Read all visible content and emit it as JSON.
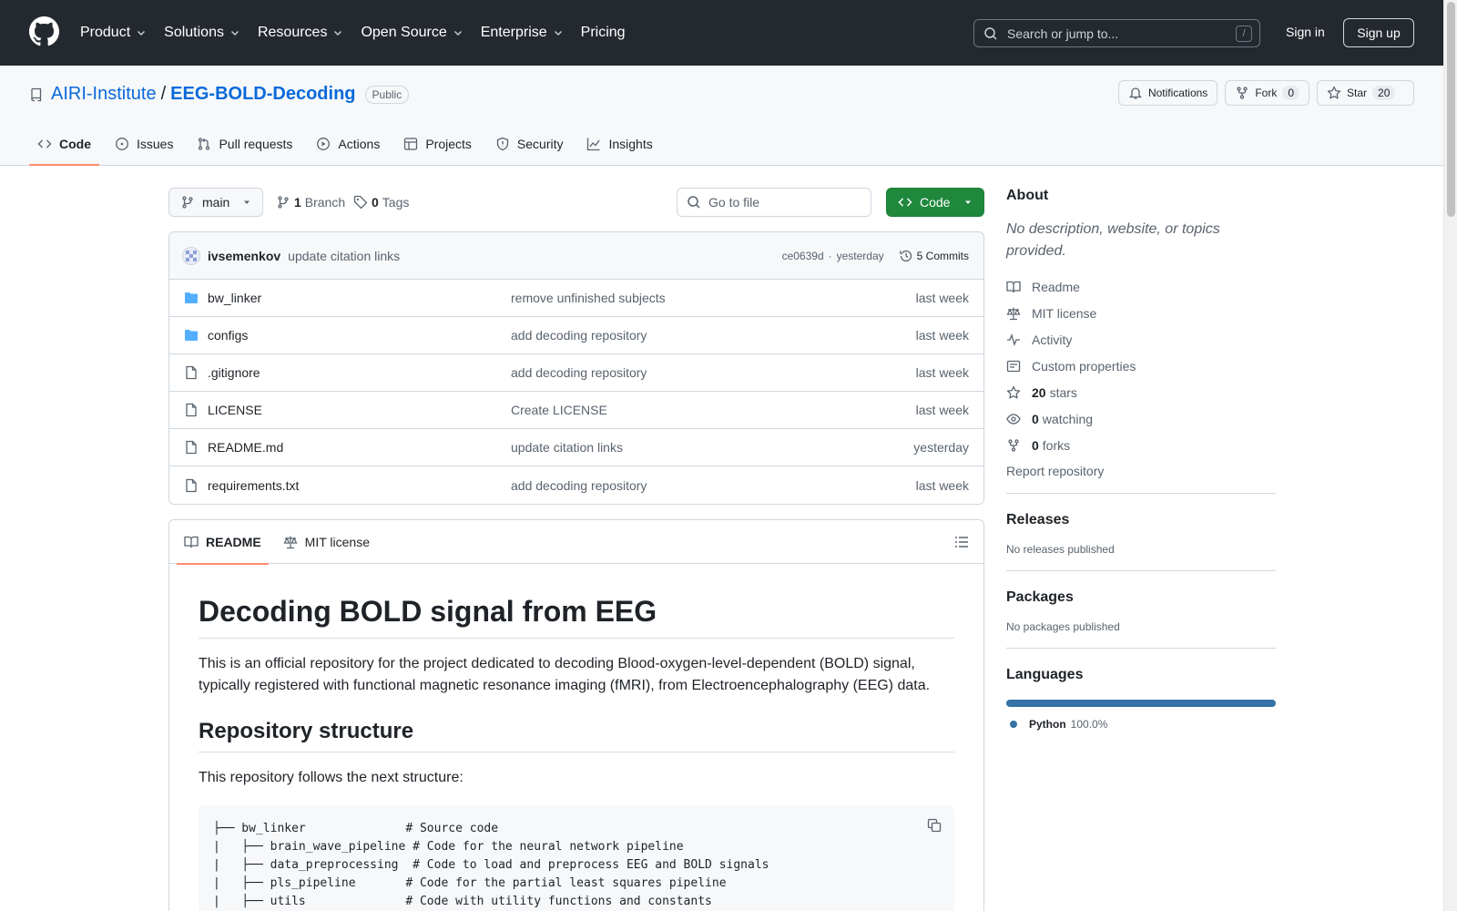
{
  "header": {
    "nav": [
      "Product",
      "Solutions",
      "Resources",
      "Open Source",
      "Enterprise",
      "Pricing"
    ],
    "search_placeholder": "Search or jump to...",
    "search_shortcut": "/",
    "sign_in": "Sign in",
    "sign_up": "Sign up"
  },
  "repo": {
    "owner": "AIRI-Institute",
    "separator": "/",
    "name": "EEG-BOLD-Decoding",
    "visibility": "Public",
    "notifications_label": "Notifications",
    "fork_label": "Fork",
    "fork_count": "0",
    "star_label": "Star",
    "star_count": "20",
    "tabs": [
      "Code",
      "Issues",
      "Pull requests",
      "Actions",
      "Projects",
      "Security",
      "Insights"
    ]
  },
  "toolbar": {
    "branch": "main",
    "branch_count": "1",
    "branch_label": "Branch",
    "tag_count": "0",
    "tag_label": "Tags",
    "goto_placeholder": "Go to file",
    "code_button": "Code"
  },
  "commit": {
    "author": "ivsemenkov",
    "message": "update citation links",
    "sha": "ce0639d",
    "separator": "·",
    "time": "yesterday",
    "commits_label": "5 Commits"
  },
  "files": [
    {
      "name": "bw_linker",
      "type": "folder",
      "message": "remove unfinished subjects",
      "date": "last week"
    },
    {
      "name": "configs",
      "type": "folder",
      "message": "add decoding repository",
      "date": "last week"
    },
    {
      "name": ".gitignore",
      "type": "file",
      "message": "add decoding repository",
      "date": "last week"
    },
    {
      "name": "LICENSE",
      "type": "file",
      "message": "Create LICENSE",
      "date": "last week"
    },
    {
      "name": "README.md",
      "type": "file",
      "message": "update citation links",
      "date": "yesterday"
    },
    {
      "name": "requirements.txt",
      "type": "file",
      "message": "add decoding repository",
      "date": "last week"
    }
  ],
  "readme": {
    "tab_readme": "README",
    "tab_license": "MIT license",
    "h1": "Decoding BOLD signal from EEG",
    "intro": "This is an official repository for the project dedicated to decoding Blood-oxygen-level-dependent (BOLD) signal, typically registered with functional magnetic resonance imaging (fMRI), from Electroencephalography (EEG) data.",
    "h2": "Repository structure",
    "structure_text": "This repository follows the next structure:",
    "code_block": "├── bw_linker              # Source code\n|   ├── brain_wave_pipeline # Code for the neural network pipeline\n|   ├── data_preprocessing  # Code to load and preprocess EEG and BOLD signals\n|   ├── pls_pipeline       # Code for the partial least squares pipeline\n|   ├── utils              # Code with utility functions and constants"
  },
  "sidebar": {
    "about_title": "About",
    "about_desc": "No description, website, or topics provided.",
    "links": [
      {
        "icon": "book-icon",
        "label": "Readme",
        "bold": ""
      },
      {
        "icon": "law-icon",
        "label": "MIT license",
        "bold": ""
      },
      {
        "icon": "pulse-icon",
        "label": "Activity",
        "bold": ""
      },
      {
        "icon": "note-icon",
        "label": "Custom properties",
        "bold": ""
      },
      {
        "icon": "star-icon",
        "label": "stars",
        "bold": "20"
      },
      {
        "icon": "eye-icon",
        "label": "watching",
        "bold": "0"
      },
      {
        "icon": "fork-icon",
        "label": "forks",
        "bold": "0"
      }
    ],
    "report": "Report repository",
    "releases_title": "Releases",
    "releases_sub": "No releases published",
    "packages_title": "Packages",
    "packages_sub": "No packages published",
    "languages_title": "Languages",
    "languages": [
      {
        "name": "Python",
        "percent": "100.0%",
        "color": "#3572A5"
      }
    ]
  }
}
